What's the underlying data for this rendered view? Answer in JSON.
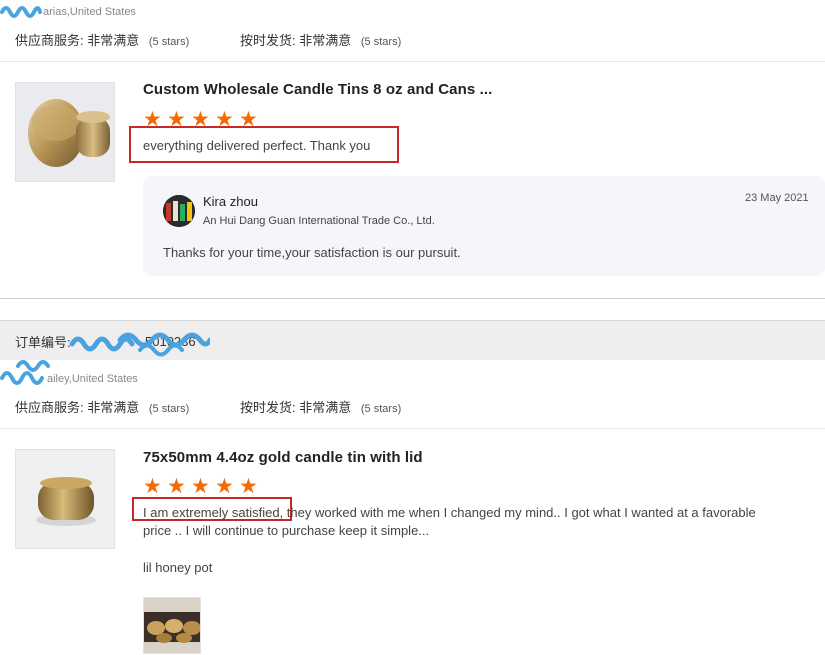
{
  "review1": {
    "buyer": "arias,United States",
    "supplier_service_label": "供应商服务:",
    "supplier_service_value": "非常满意",
    "supplier_service_stars": "(5 stars)",
    "shipping_label": "按时发货:",
    "shipping_value": "非常满意",
    "shipping_stars": "(5 stars)",
    "product_title": "Custom Wholesale Candle Tins 8 oz and Cans ...",
    "rating": 5,
    "text": "everything delivered perfect. Thank you",
    "reply": {
      "name": "Kira zhou",
      "company": "An Hui Dang Guan International Trade Co., Ltd.",
      "date": "23 May 2021",
      "text": "Thanks for your time,your satisfaction is our pursuit."
    }
  },
  "order": {
    "label": "订单编号:",
    "number_partial": "5010236"
  },
  "review2": {
    "buyer": "ailey,United States",
    "supplier_service_label": "供应商服务:",
    "supplier_service_value": "非常满意",
    "supplier_service_stars": "(5 stars)",
    "shipping_label": "按时发货:",
    "shipping_value": "非常满意",
    "shipping_stars": "(5 stars)",
    "product_title": "75x50mm 4.4oz gold candle tin with lid",
    "rating": 5,
    "text_highlighted": "I am extremely satisfied",
    "text_rest": ", they worked with me when I changed my mind.. I got what I wanted at a favorable",
    "text_line2": "price .. I will continue to purchase keep it simple...",
    "text_extra": "lil honey pot"
  },
  "colors": {
    "star": "#f56a00",
    "highlight_border": "#c62828",
    "scribble": "#4aa3e0",
    "reply_bg": "#f5f6fa"
  }
}
